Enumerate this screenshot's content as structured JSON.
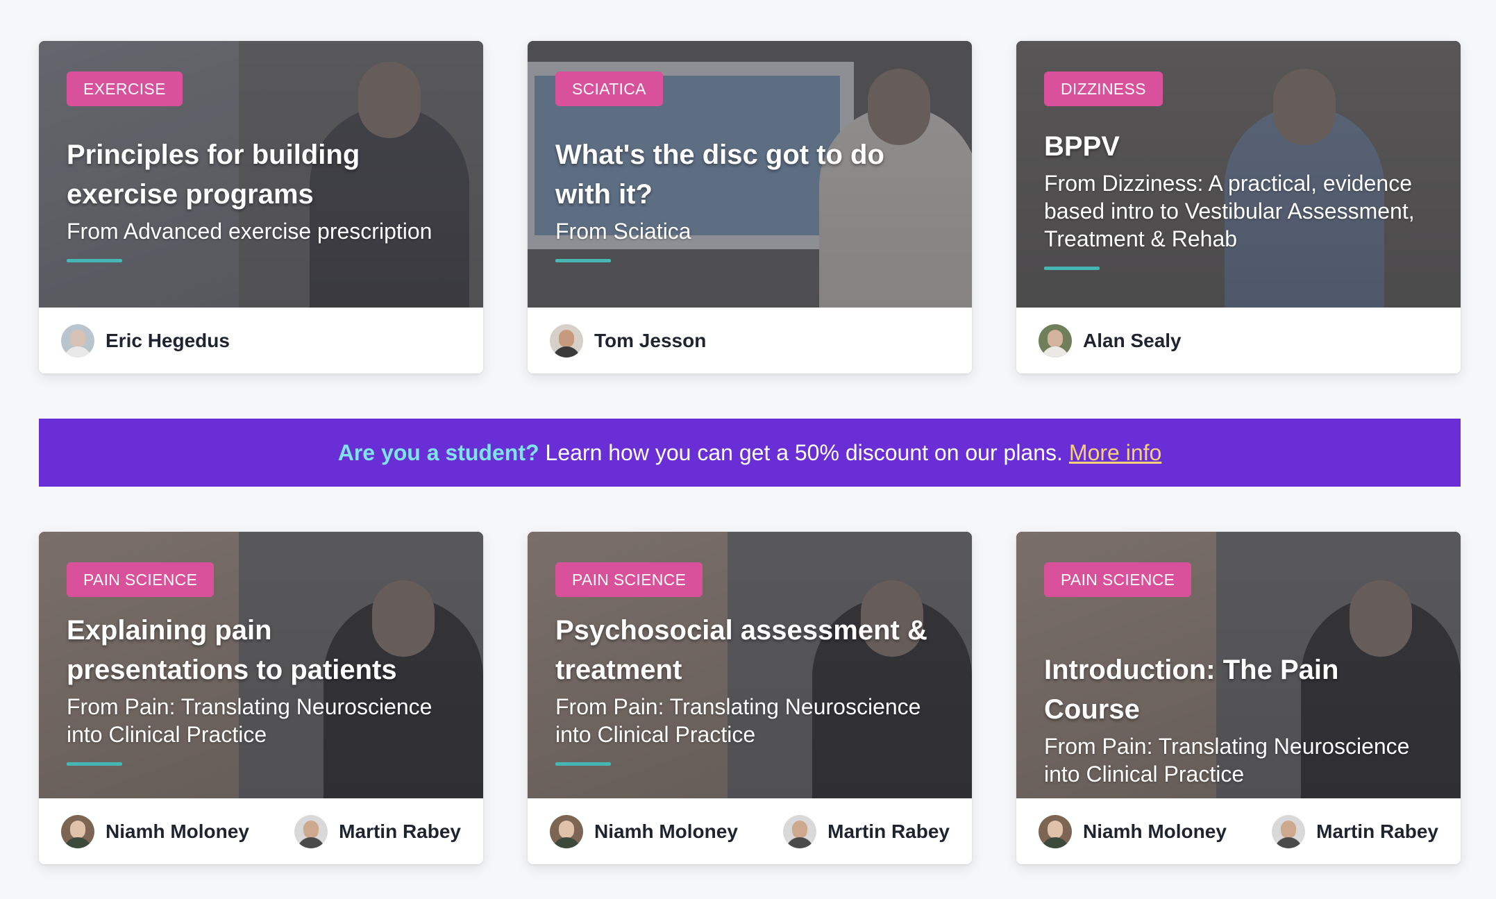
{
  "cards_top": [
    {
      "tag": "EXERCISE",
      "title": "Principles for building exercise programs",
      "subtitle": "From Advanced exercise prescription",
      "authors": [
        "Eric Hegedus"
      ]
    },
    {
      "tag": "SCIATICA",
      "title": "What's the disc got to do with it?",
      "subtitle": "From Sciatica",
      "authors": [
        "Tom Jesson"
      ]
    },
    {
      "tag": "DIZZINESS",
      "title": "BPPV",
      "subtitle": "From Dizziness: A practical, evidence based intro to Vestibular Assessment, Treatment & Rehab",
      "authors": [
        "Alan Sealy"
      ]
    }
  ],
  "banner": {
    "lead": "Are you a student?",
    "text": "Learn how you can get a 50% discount on our plans.",
    "link": "More info"
  },
  "cards_bottom": [
    {
      "tag": "PAIN SCIENCE",
      "title": "Explaining pain presentations to patients",
      "subtitle": "From Pain: Translating Neuroscience into Clinical Practice",
      "authors": [
        "Niamh Moloney",
        "Martin Rabey"
      ]
    },
    {
      "tag": "PAIN SCIENCE",
      "title": "Psychosocial assessment & treatment",
      "subtitle": "From Pain: Translating Neuroscience into Clinical Practice",
      "authors": [
        "Niamh Moloney",
        "Martin Rabey"
      ]
    },
    {
      "tag": "PAIN SCIENCE",
      "title": "Introduction: The Pain Course",
      "subtitle": "From Pain: Translating Neuroscience into Clinical Practice",
      "authors": [
        "Niamh Moloney",
        "Martin Rabey"
      ]
    }
  ],
  "colors": {
    "tag_bg": "#d9519a",
    "accent_line": "#45b6b3",
    "banner_bg": "#6a2ed6",
    "banner_lead": "#7fe3ee",
    "banner_link": "#f4d27a"
  }
}
